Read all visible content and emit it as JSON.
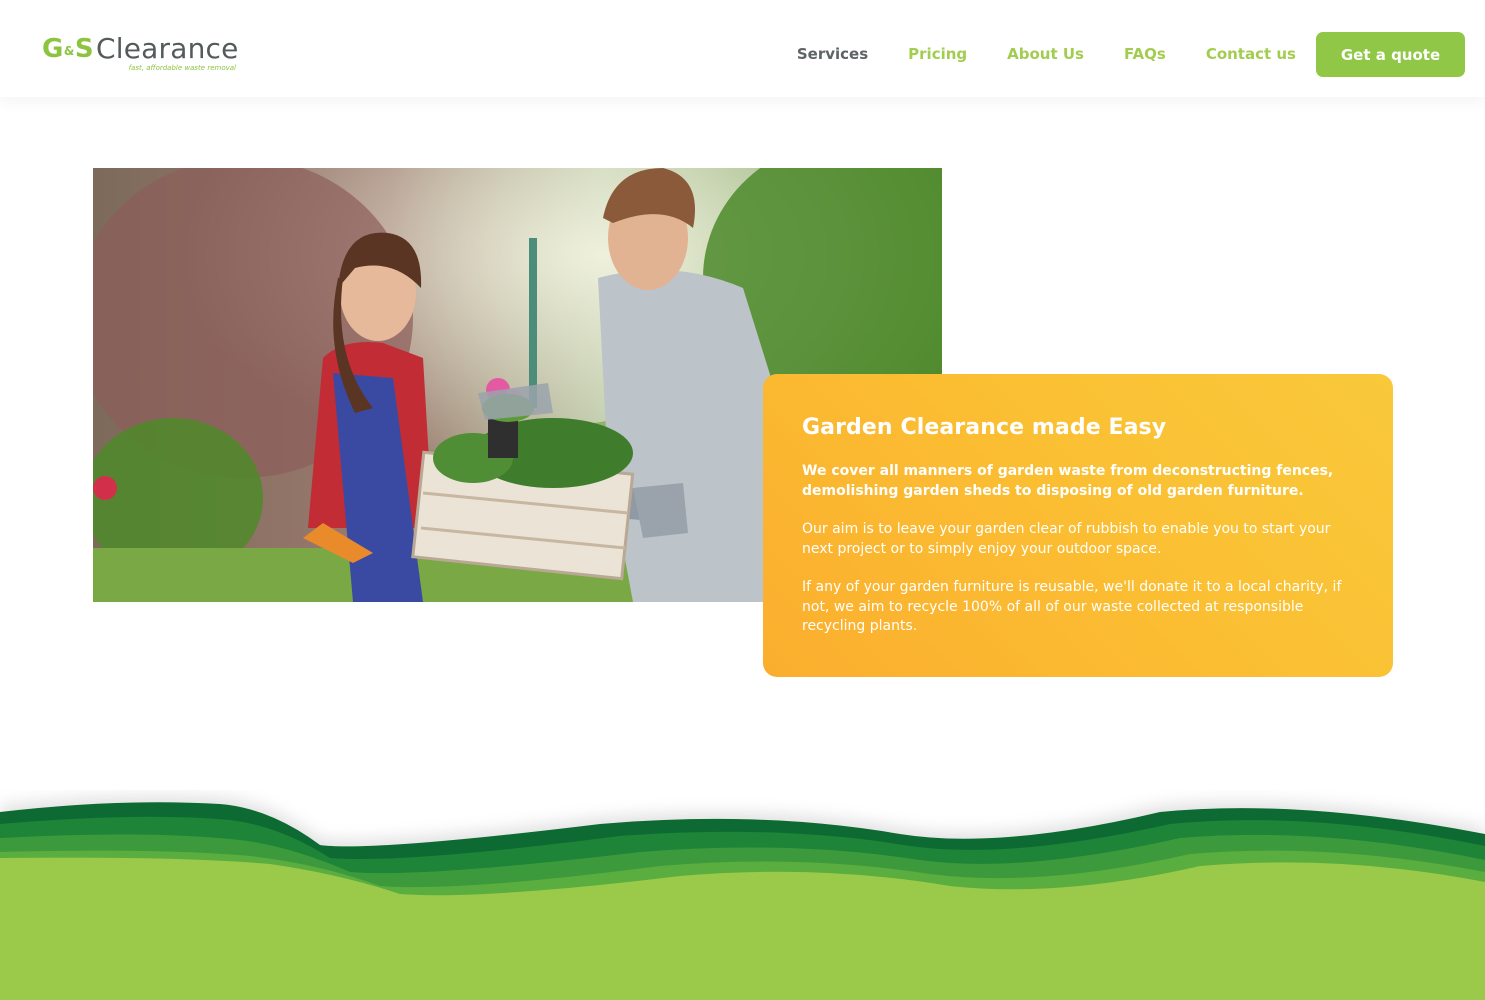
{
  "brand": {
    "mark_g": "G",
    "mark_amp": "&",
    "mark_s": "S",
    "name": "Clearance",
    "tagline": "fast, affordable waste removal",
    "green": "#8cc43f",
    "grey": "#555a5c"
  },
  "nav": {
    "items": [
      {
        "label": "Services",
        "active": true
      },
      {
        "label": "Pricing"
      },
      {
        "label": "About Us"
      },
      {
        "label": "FAQs"
      },
      {
        "label": "Contact us"
      }
    ],
    "cta": "Get a quote"
  },
  "hero": {
    "image_alt": "",
    "card": {
      "title": "Garden Clearance made Easy",
      "lead": "We cover all manners of garden waste from deconstructing fences, demolishing garden sheds to disposing of old garden furniture.",
      "para1": "Our aim is to leave your garden clear of rubbish to enable you to start your next project or to simply enjoy your outdoor space.",
      "para2": "If any of your garden furniture is reusable, we'll donate it to a local charity, if not, we aim to recycle 100% of all of our waste collected at responsible recycling plants.",
      "color": "#fbb630"
    }
  },
  "footer_colors": {
    "light_green": "#9bc94a",
    "dark_green": "#0e6b33"
  }
}
